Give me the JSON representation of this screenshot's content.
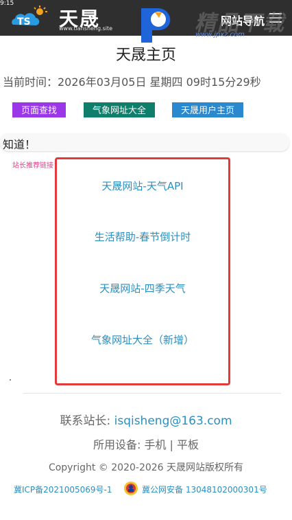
{
  "header": {
    "top_number": "9:15",
    "logo_text": "天晟",
    "logo_domain": "www.tiansheng.site",
    "nav_label": "网站导航",
    "watermark_text": "精品下载",
    "watermark_url": "www.jpxz.com"
  },
  "page": {
    "title": "天晟主页",
    "time_text": "当前时间：2026年03月05日 星期四 09时15分29秒"
  },
  "buttons": {
    "search": "页面查找",
    "weather": "气象网址大全",
    "user": "天晟用户主页"
  },
  "notice": {
    "text": "知道！"
  },
  "recommend": {
    "label": "站长推荐链接",
    "links": [
      "天晟网站-天气API",
      "生活帮助-春节倒计时",
      "天晟网站-四季天气",
      "气象网址大全（新增）"
    ]
  },
  "footer": {
    "contact_label": "联系站长: ",
    "contact_email": "isqisheng@163.com",
    "device_text": "所用设备: 手机 | 平板",
    "copyright": "Copyright © 2020-2026 天晟网站版权所有",
    "icp": "冀ICP备2021005069号-1",
    "gongan": "冀公网安备 13048102000301号"
  },
  "colors": {
    "topbar": "#2f2f2f",
    "search_btn": "#9a37e6",
    "weather_btn": "#0f7f6c",
    "user_btn": "#2a88cf",
    "link": "#2b8fc0",
    "rec_border": "#e23a3a"
  }
}
